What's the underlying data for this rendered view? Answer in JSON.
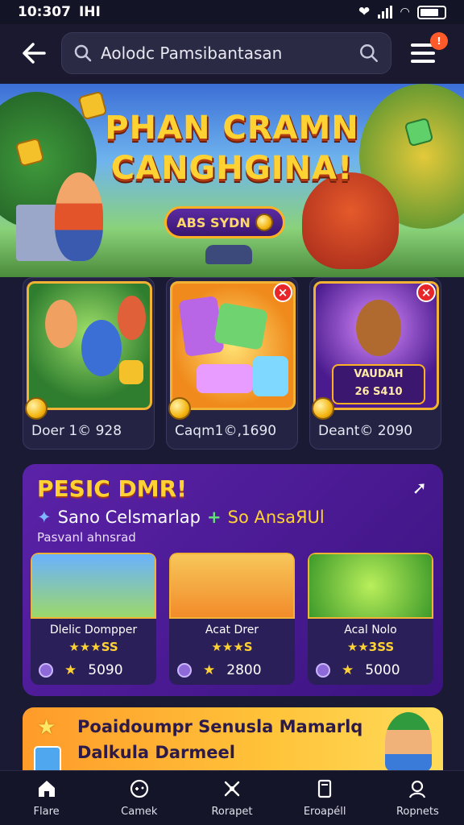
{
  "status_bar": {
    "time": "10:307",
    "left_extra": "IHI"
  },
  "top_bar": {
    "search_value": "Aolodc Pamsibantasan"
  },
  "hero": {
    "title_line1": "PHAN CRAMN",
    "title_line2": "CANGHGINA!",
    "button_label": "ABS SYDN"
  },
  "game_cards": [
    {
      "label": "Doer 1© 928",
      "has_close": false
    },
    {
      "label": "Caqm1©,1690",
      "has_close": true
    },
    {
      "label": "Deant© 2090",
      "has_close": true,
      "tag_line1": "VAUDAH",
      "tag_line2": "26 S410"
    }
  ],
  "promo": {
    "title": "PESIC DMR!",
    "subtitle": "Sano Celsmarlap",
    "subtitle_accent": "So AnsaЯUl",
    "note": "Pasvanl ahnsrad",
    "items": [
      {
        "name": "Dlelic Dompper",
        "stars": "★★★SS",
        "price": "5090"
      },
      {
        "name": "Acat Drer",
        "stars": "★★★S",
        "price": "2800"
      },
      {
        "name": "Acal Nolo",
        "stars": "★★3SS",
        "price": "5000"
      }
    ]
  },
  "banner": {
    "line1": "Poaidoumpr Senusla Mamarlq",
    "line2": "Dalkula Darmeel"
  },
  "bottom_nav": [
    {
      "label": "Flare",
      "icon": "home-icon"
    },
    {
      "label": "Camek",
      "icon": "gamepad-icon"
    },
    {
      "label": "Rorapet",
      "icon": "spark-icon"
    },
    {
      "label": "Eroapéll",
      "icon": "card-icon"
    },
    {
      "label": "Ropnets",
      "icon": "profile-icon"
    }
  ],
  "colors": {
    "accent": "#ffd233",
    "panel": "#5b22a8",
    "close": "#e8262a"
  }
}
